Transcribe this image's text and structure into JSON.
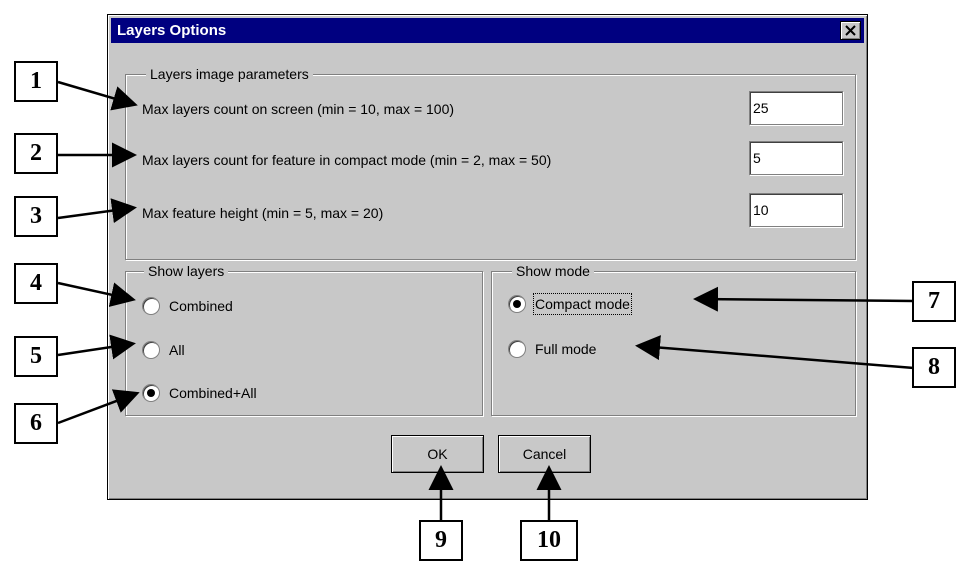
{
  "dialog": {
    "title": "Layers Options",
    "close_icon": "close-x-icon"
  },
  "image_params": {
    "legend": "Layers image parameters",
    "rows": [
      {
        "label": "Max layers count on screen (min = 10, max = 100)",
        "value": "25"
      },
      {
        "label": "Max layers count for feature in compact mode (min = 2, max = 50)",
        "value": "5"
      },
      {
        "label": "Max feature height (min = 5, max = 20)",
        "value": "10"
      }
    ]
  },
  "show_layers": {
    "legend": "Show layers",
    "options": [
      {
        "label": "Combined",
        "checked": false
      },
      {
        "label": "All",
        "checked": false
      },
      {
        "label": "Combined+All",
        "checked": true
      }
    ]
  },
  "show_mode": {
    "legend": "Show mode",
    "options": [
      {
        "label": "Compact mode",
        "checked": true
      },
      {
        "label": "Full mode",
        "checked": false
      }
    ]
  },
  "buttons": {
    "ok": "OK",
    "cancel": "Cancel"
  },
  "callouts": [
    "1",
    "2",
    "3",
    "4",
    "5",
    "6",
    "7",
    "8",
    "9",
    "10"
  ]
}
